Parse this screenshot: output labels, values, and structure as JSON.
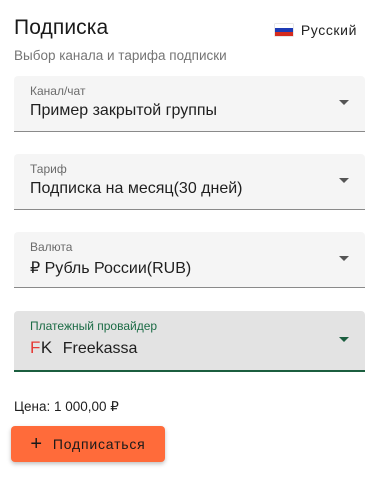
{
  "header": {
    "title": "Подписка",
    "subtitle": "Выбор канала и тарифа подписки"
  },
  "language": {
    "label": "Русский",
    "flag_icon": "russia-flag-icon"
  },
  "fields": {
    "channel": {
      "label": "Канал/чат",
      "value": "Пример закрытой группы"
    },
    "tariff": {
      "label": "Тариф",
      "value": "Подписка на месяц(30 дней)"
    },
    "currency": {
      "label": "Валюта",
      "value": "₽ Рубль России(RUB)"
    },
    "provider": {
      "label": "Платежный провайдер",
      "value": "Freekassa",
      "logo_f": "F",
      "logo_k": "K"
    }
  },
  "price": {
    "text": "Цена: 1 000,00 ₽"
  },
  "subscribe_button": {
    "label": "Подписаться",
    "icon": "+"
  },
  "colors": {
    "accent": "#ff6b3a",
    "active_underline": "#1b5e3f",
    "logo_red": "#e53935"
  }
}
